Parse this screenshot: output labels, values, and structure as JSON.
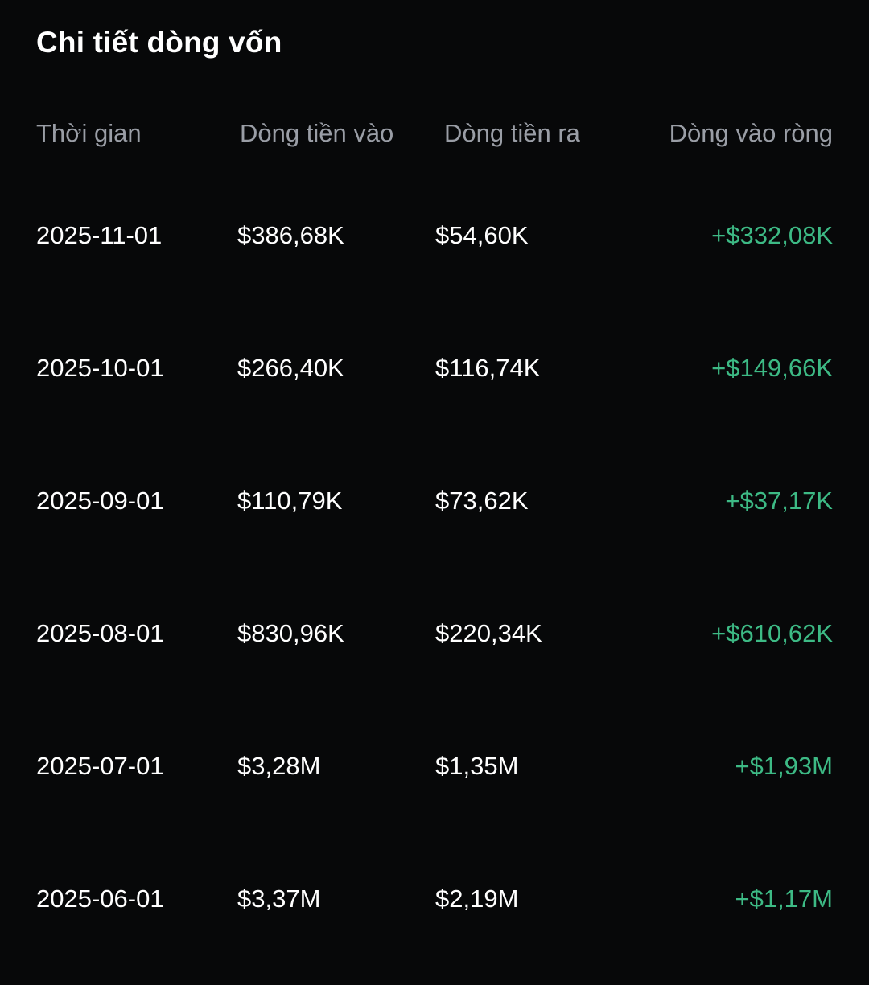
{
  "title": "Chi tiết dòng vốn",
  "columns": {
    "time": "Thời gian",
    "inflow": "Dòng tiền vào",
    "outflow": "Dòng tiền ra",
    "net": "Dòng vào ròng"
  },
  "colors": {
    "background": "#070809",
    "header_text": "#9a9ea6",
    "positive": "#3dba85"
  },
  "rows": [
    {
      "time": "2025-11-01",
      "inflow": "$386,68K",
      "outflow": "$54,60K",
      "net": "+$332,08K"
    },
    {
      "time": "2025-10-01",
      "inflow": "$266,40K",
      "outflow": "$116,74K",
      "net": "+$149,66K"
    },
    {
      "time": "2025-09-01",
      "inflow": "$110,79K",
      "outflow": "$73,62K",
      "net": "+$37,17K"
    },
    {
      "time": "2025-08-01",
      "inflow": "$830,96K",
      "outflow": "$220,34K",
      "net": "+$610,62K"
    },
    {
      "time": "2025-07-01",
      "inflow": "$3,28M",
      "outflow": "$1,35M",
      "net": "+$1,93M"
    },
    {
      "time": "2025-06-01",
      "inflow": "$3,37M",
      "outflow": "$2,19M",
      "net": "+$1,17M"
    }
  ]
}
